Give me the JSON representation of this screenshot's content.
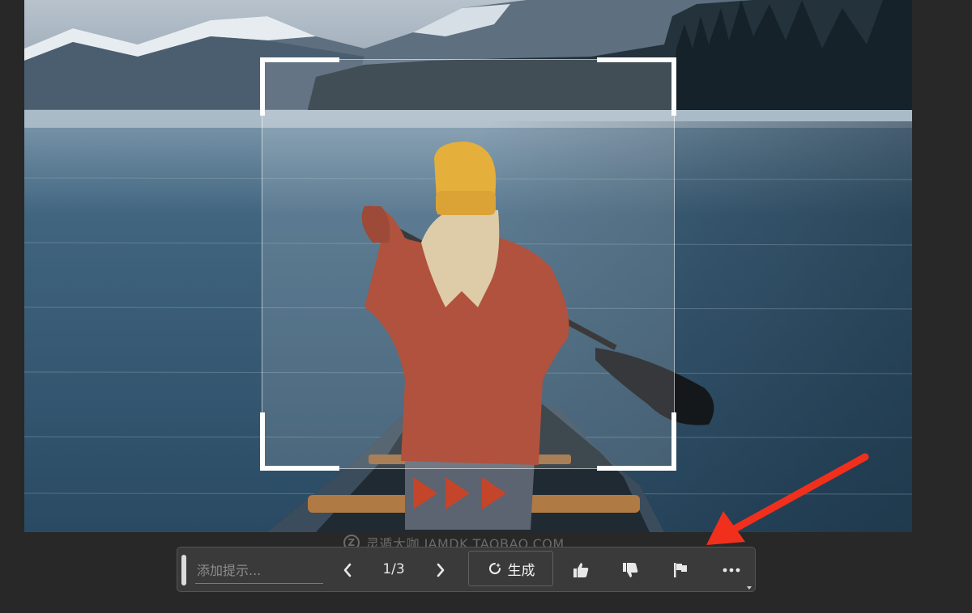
{
  "canvas": {
    "image_alt": "Woman in orange sweater and yellow beanie paddling a canoe on a mountain lake",
    "selection": "generative-fill-selection"
  },
  "watermark": {
    "logo": "Z",
    "text": "灵遁大咖  JAMDK.TAOBAO.COM"
  },
  "toolbar": {
    "prompt_placeholder": "添加提示...",
    "prompt_value": "",
    "prev_icon": "chevron-left-icon",
    "page_counter": "1/3",
    "next_icon": "chevron-right-icon",
    "generate_label": "生成",
    "generate_icon": "sparkle-refresh-icon",
    "like_icon": "thumbs-up-icon",
    "dislike_icon": "thumbs-down-icon",
    "flag_icon": "flag-icon",
    "more_icon": "ellipsis-icon"
  },
  "annotation": {
    "arrow_color": "#f0301c",
    "arrow_icon": "red-arrow-icon"
  },
  "colors": {
    "background": "#282828",
    "toolbar": "#3a3a3a",
    "accent_arrow": "#f0301c"
  }
}
